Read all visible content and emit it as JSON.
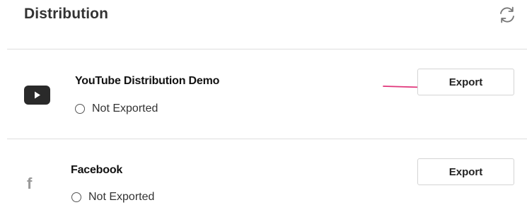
{
  "header": {
    "title": "Distribution",
    "refresh_icon": "refresh-icon"
  },
  "items": [
    {
      "icon": "youtube-icon",
      "name": "YouTube Distribution Demo",
      "status": "Not Exported",
      "export_label": "Export"
    },
    {
      "icon": "facebook-icon",
      "icon_glyph": "f",
      "name": "Facebook",
      "status": "Not Exported",
      "export_label": "Export"
    }
  ],
  "annotation": {
    "type": "arrow",
    "points_to": "youtube-export-button",
    "color": "#e0357a"
  }
}
